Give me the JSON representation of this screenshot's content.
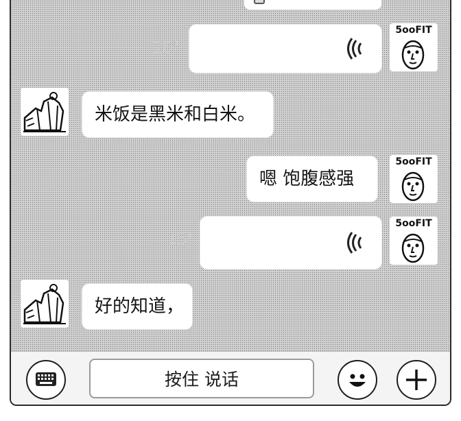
{
  "messages": [
    {
      "side": "right",
      "type": "voice",
      "duration": "20\""
    },
    {
      "side": "left",
      "type": "text",
      "text": "米饭是黑米和白米。"
    },
    {
      "side": "right",
      "type": "text",
      "text": "嗯 饱腹感强"
    },
    {
      "side": "right",
      "type": "voice",
      "duration": "15\""
    },
    {
      "side": "left",
      "type": "text",
      "text": "好的知道，"
    }
  ],
  "avatar_right": {
    "brand": "5ooFIT"
  },
  "input_bar": {
    "hold_to_talk": "按住 说话",
    "keyboard_icon": "keyboard-icon",
    "emoji_icon": "emoji-icon",
    "plus_icon": "plus-icon"
  },
  "colors": {
    "chat_bg": "#d0d0d0",
    "bubble": "#ffffff",
    "text": "#141414"
  }
}
